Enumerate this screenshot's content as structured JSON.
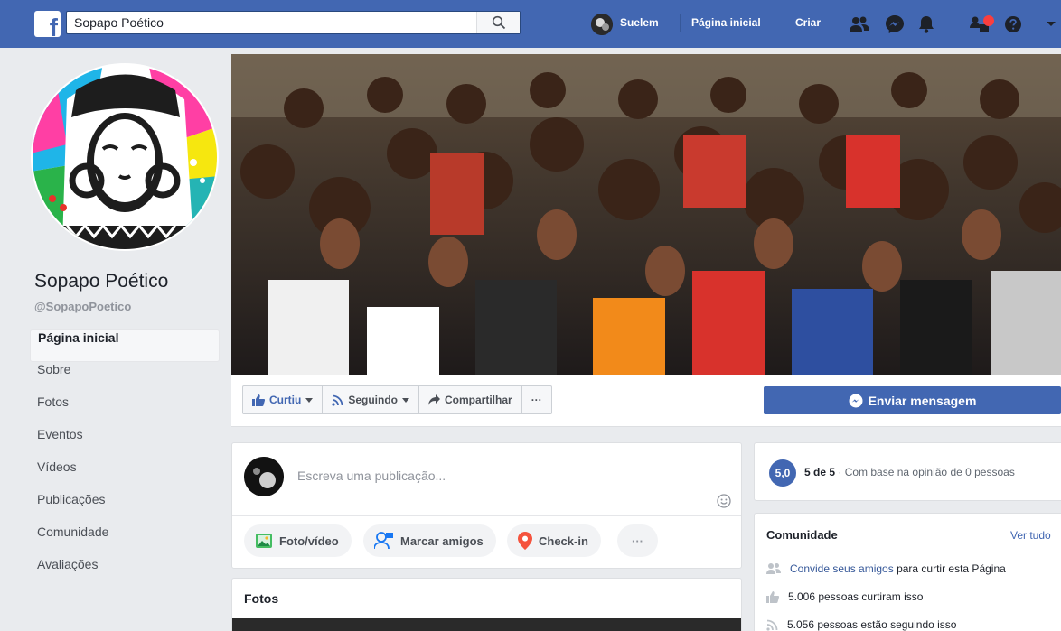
{
  "topbar": {
    "search_value": "Sopapo Poético",
    "user_name": "Suelem",
    "home_label": "Página inicial",
    "create_label": "Criar",
    "logo_letter": "f"
  },
  "page": {
    "name": "Sopapo Poético",
    "handle": "@SopapoPoetico"
  },
  "nav": {
    "items": [
      {
        "label": "Página inicial",
        "active": true
      },
      {
        "label": "Sobre"
      },
      {
        "label": "Fotos"
      },
      {
        "label": "Eventos"
      },
      {
        "label": "Vídeos"
      },
      {
        "label": "Publicações"
      },
      {
        "label": "Comunidade"
      },
      {
        "label": "Avaliações"
      }
    ]
  },
  "actions": {
    "like_label": "Curtiu",
    "follow_label": "Seguindo",
    "share_label": "Compartilhar",
    "more_label": "···",
    "message_label": "Enviar mensagem"
  },
  "composer": {
    "placeholder": "Escreva uma publicação...",
    "photo_label": "Foto/vídeo",
    "tag_label": "Marcar amigos",
    "checkin_label": "Check-in",
    "more_label": "···"
  },
  "fotos": {
    "title": "Fotos"
  },
  "rating": {
    "badge": "5,0",
    "score": "5 de 5",
    "basis": " · Com base na opinião de 0 pessoas"
  },
  "community": {
    "title": "Comunidade",
    "see_all": "Ver tudo",
    "invite_link": "Convide seus amigos",
    "invite_rest": " para curtir esta Página",
    "likes": "5.006 pessoas curtiram isso",
    "follows": "5.056 pessoas estão seguindo isso"
  },
  "colors": {
    "brand_blue": "#4267b2",
    "background": "#e9ebee",
    "notification_red": "#fa3e3e"
  }
}
